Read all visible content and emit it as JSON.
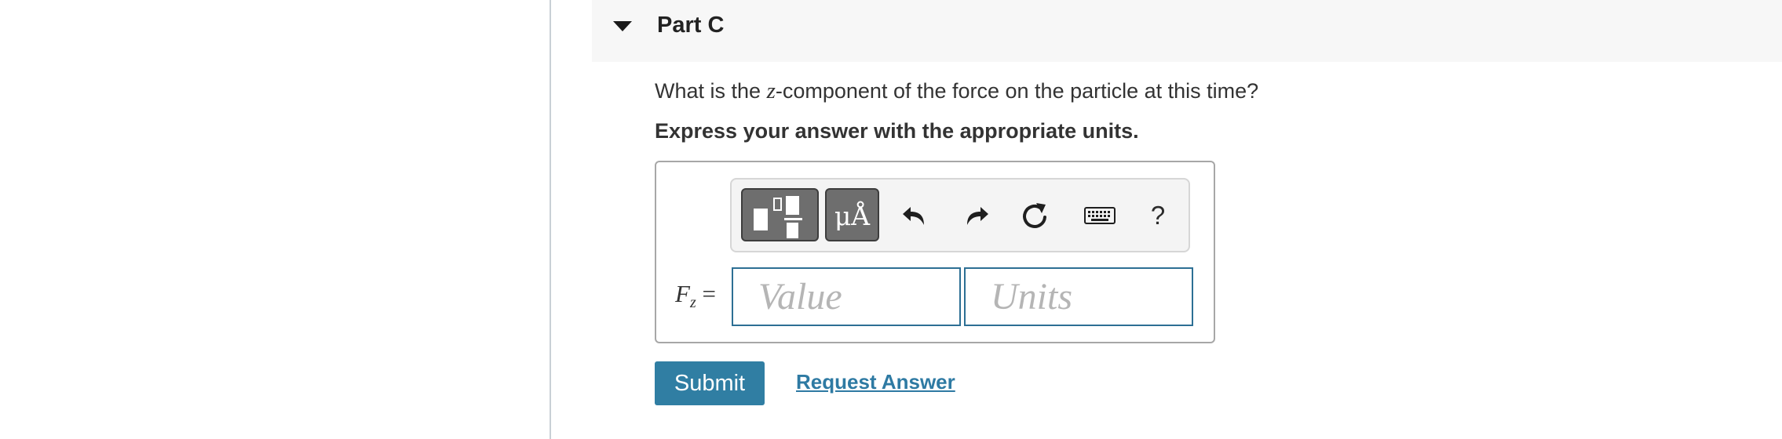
{
  "part": {
    "title": "Part C"
  },
  "question": {
    "prefix": "What is the ",
    "variable": "z",
    "suffix": "-component of the force on the particle at this time?"
  },
  "instruction": "Express your answer with the appropriate units.",
  "toolbar": {
    "templates_icon": "templates-icon",
    "symbols_label": "μÅ",
    "undo_icon": "undo-icon",
    "redo_icon": "redo-icon",
    "reset_icon": "reset-icon",
    "keyboard_icon": "keyboard-icon",
    "help_label": "?"
  },
  "answer": {
    "label_symbol": "F",
    "label_subscript": "z",
    "label_equals": " =",
    "value_placeholder": "Value",
    "units_placeholder": "Units"
  },
  "actions": {
    "submit_label": "Submit",
    "request_answer_label": "Request Answer"
  },
  "colors": {
    "accent": "#307ea3",
    "input_border": "#2d6f94",
    "link": "#2e7aa3"
  }
}
